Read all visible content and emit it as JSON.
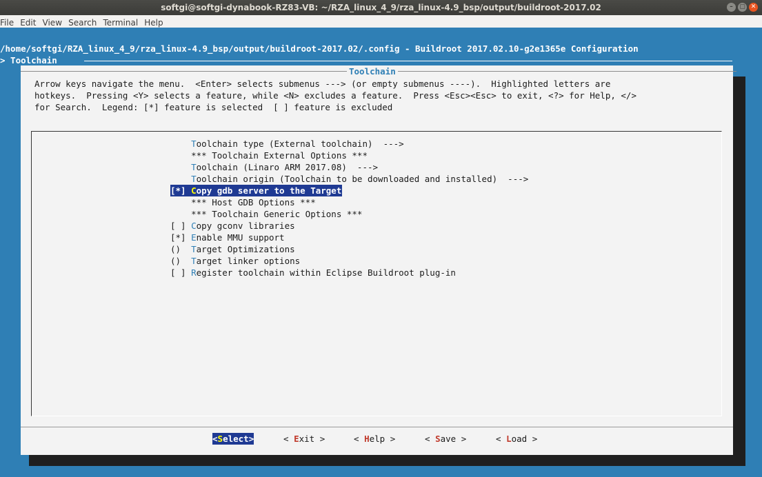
{
  "window": {
    "title": "softgi@softgi-dynabook-RZ83-VB: ~/RZA_linux_4_9/rza_linux-4.9_bsp/output/buildroot-2017.02",
    "buttons": {
      "minimize": "–",
      "maximize": "▢",
      "close": "✕"
    }
  },
  "menubar": [
    "File",
    "Edit",
    "View",
    "Search",
    "Terminal",
    "Help"
  ],
  "header": {
    "line1": "/home/softgi/RZA_linux_4_9/rza_linux-4.9_bsp/output/buildroot-2017.02/.config - Buildroot 2017.02.10-g2e1365e Configuration",
    "line2": "> Toolchain"
  },
  "dialog": {
    "title": "Toolchain",
    "help": [
      "Arrow keys navigate the menu.  <Enter> selects submenus ---> (or empty submenus ----).  Highlighted letters are",
      "hotkeys.  Pressing <Y> selects a feature, while <N> excludes a feature.  Press <Esc><Esc> to exit, <?> for Help, </>",
      "for Search.  Legend: [*] feature is selected  [ ] feature is excluded"
    ],
    "items": [
      {
        "prefix": "    ",
        "hotkey": "T",
        "rest": "oolchain type (External toolchain)  --->",
        "selected": false
      },
      {
        "prefix": "    ",
        "hotkey": "",
        "rest": "*** Toolchain External Options ***",
        "selected": false
      },
      {
        "prefix": "    ",
        "hotkey": "T",
        "rest": "oolchain (Linaro ARM 2017.08)  --->",
        "selected": false
      },
      {
        "prefix": "    ",
        "hotkey": "T",
        "rest": "oolchain origin (Toolchain to be downloaded and installed)  --->",
        "selected": false
      },
      {
        "prefix": "[*] ",
        "hotkey": "C",
        "rest": "opy gdb server to the Target",
        "selected": true
      },
      {
        "prefix": "    ",
        "hotkey": "",
        "rest": "*** Host GDB Options ***",
        "selected": false
      },
      {
        "prefix": "    ",
        "hotkey": "",
        "rest": "*** Toolchain Generic Options ***",
        "selected": false
      },
      {
        "prefix": "[ ] ",
        "hotkey": "C",
        "rest": "opy gconv libraries",
        "selected": false
      },
      {
        "prefix": "[*] ",
        "hotkey": "E",
        "rest": "nable MMU support",
        "selected": false
      },
      {
        "prefix": "()  ",
        "hotkey": "T",
        "rest": "arget Optimizations",
        "selected": false
      },
      {
        "prefix": "()  ",
        "hotkey": "T",
        "rest": "arget linker options",
        "selected": false
      },
      {
        "prefix": "[ ] ",
        "hotkey": "R",
        "rest": "egister toolchain within Eclipse Buildroot plug-in",
        "selected": false
      }
    ],
    "buttons": [
      {
        "pre": "<",
        "hotkey": "S",
        "rest": "elect>",
        "selected": true
      },
      {
        "pre": "< ",
        "hotkey": "E",
        "rest": "xit >",
        "selected": false
      },
      {
        "pre": "< ",
        "hotkey": "H",
        "rest": "elp >",
        "selected": false
      },
      {
        "pre": "< ",
        "hotkey": "S",
        "rest": "ave >",
        "selected": false
      },
      {
        "pre": "< ",
        "hotkey": "L",
        "rest": "oad >",
        "selected": false
      }
    ]
  },
  "colors": {
    "terminal_bg": "#2f7fb5",
    "dialog_bg": "#f3f3f3",
    "highlight": "#1f3a93",
    "hotkey": "#2f7fb5",
    "button_hotkey": "#c0392b"
  }
}
